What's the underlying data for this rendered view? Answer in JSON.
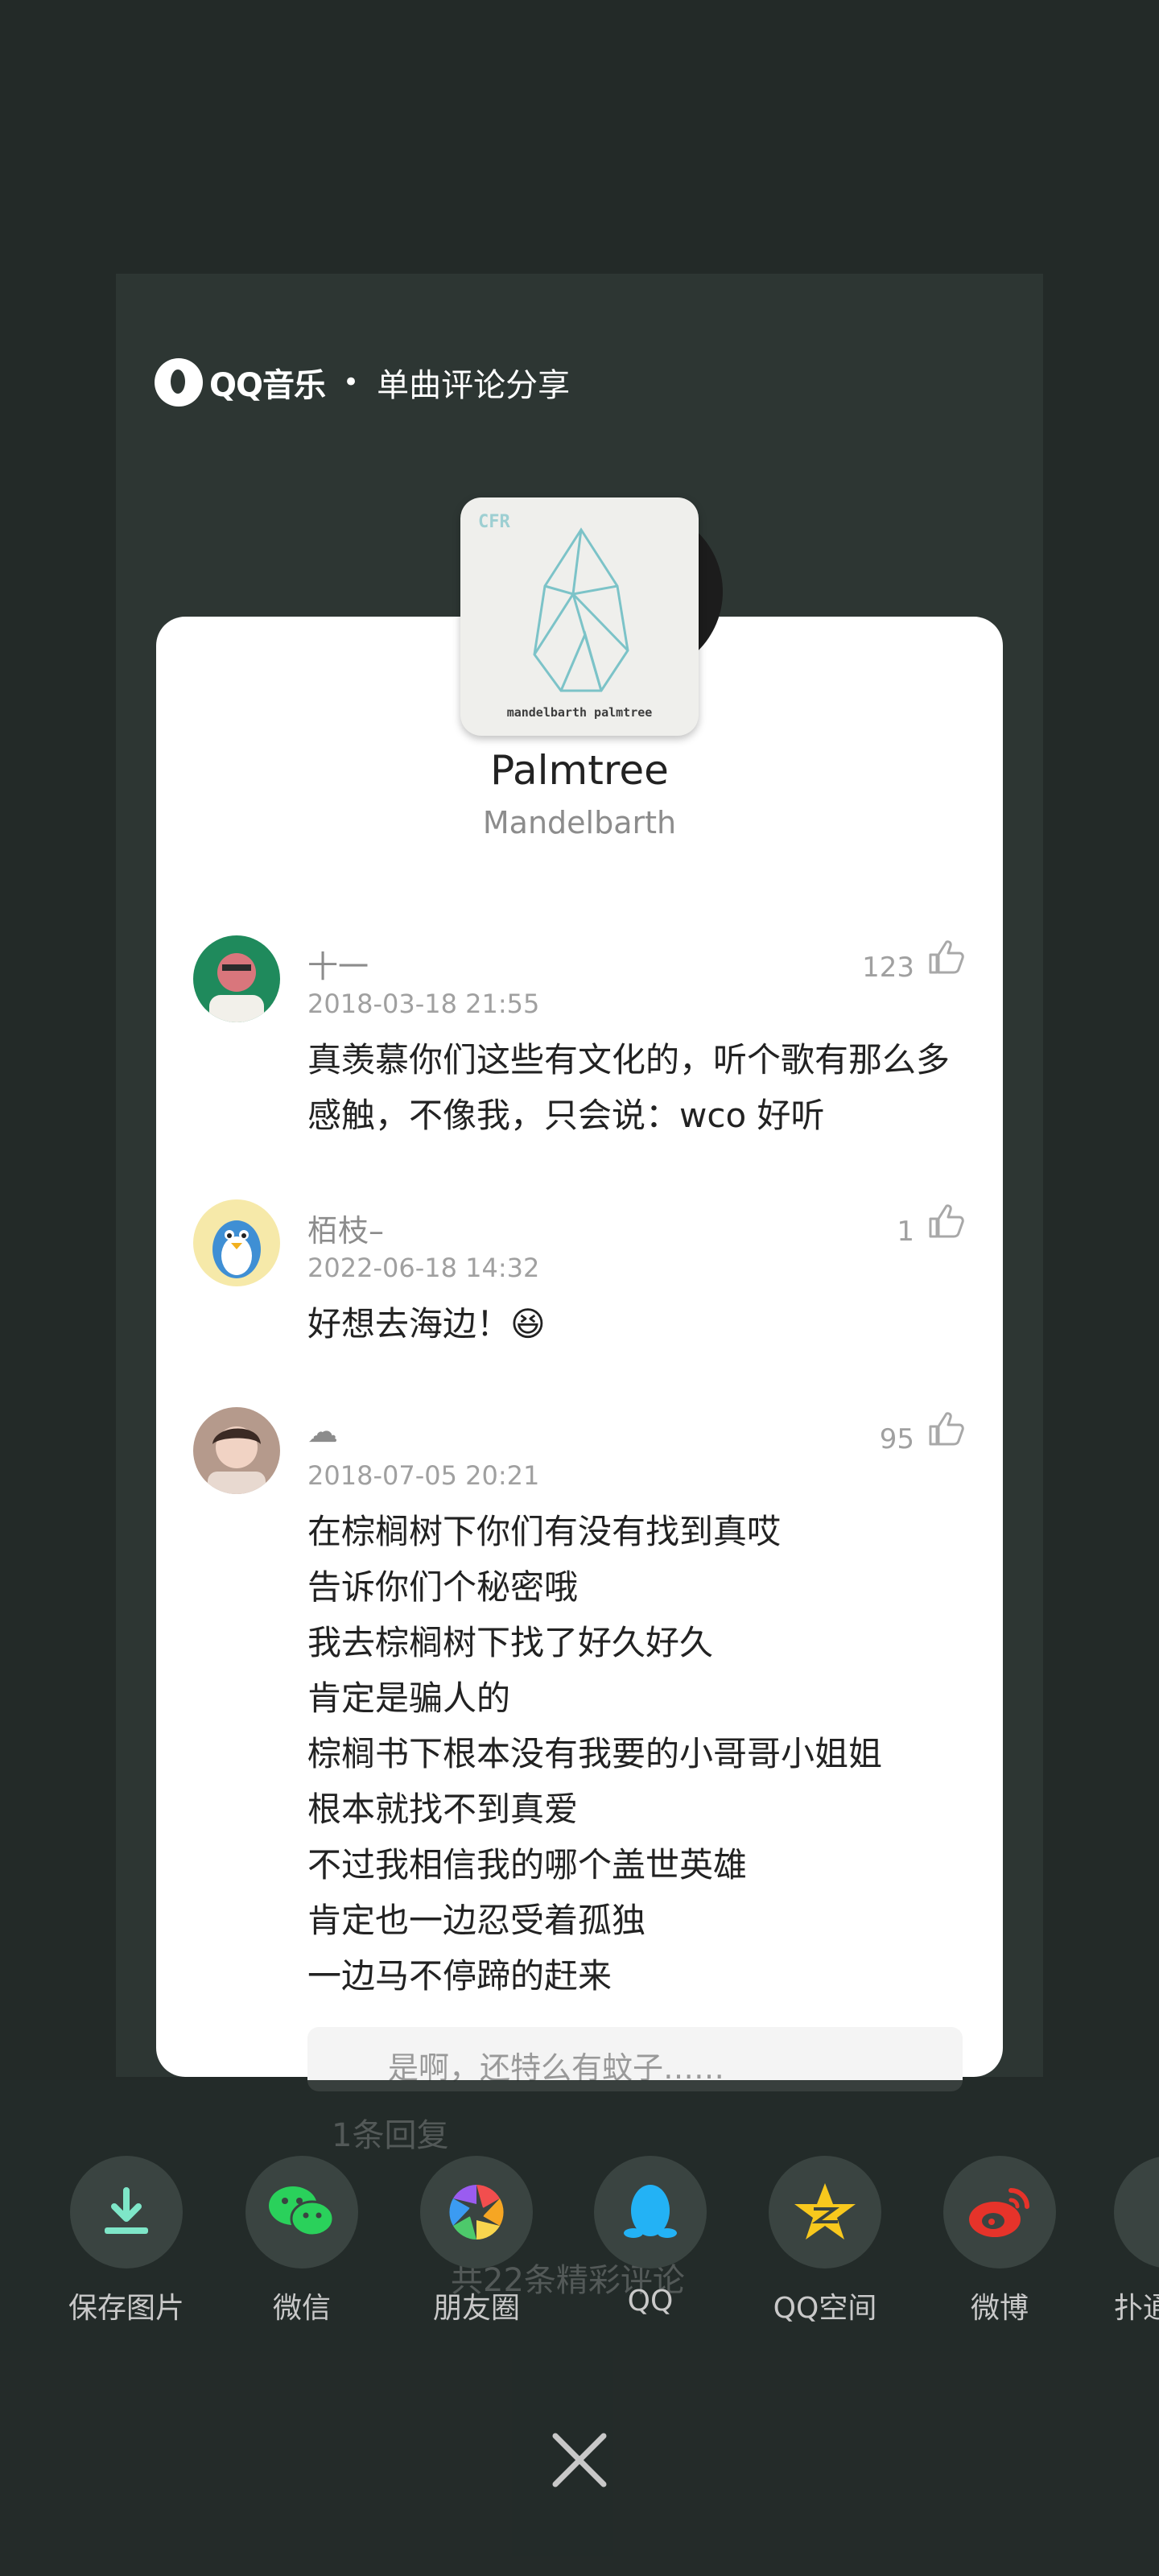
{
  "header": {
    "brand": "QQ音乐",
    "separator": "•",
    "subtitle": "单曲评论分享"
  },
  "song": {
    "title": "Palmtree",
    "artist": "Mandelbarth",
    "cover_top": "CFR",
    "cover_bottom": "mandelbarth palmtree"
  },
  "comments": [
    {
      "user": "十一",
      "time": "2018-03-18 21:55",
      "likes": "123",
      "text": "真羡慕你们这些有文化的，听个歌有那么多感触，不像我，只会说：wco 好听"
    },
    {
      "user": "栢枝–",
      "time": "2022-06-18 14:32",
      "likes": "1",
      "text": "好想去海边！😆"
    },
    {
      "user": "☁",
      "time": "2018-07-05 20:21",
      "likes": "95",
      "lines": [
        "在棕榈树下你们有没有找到真哎",
        "告诉你们个秘密哦",
        "我去棕榈树下找了好久好久",
        "肯定是骗人的",
        "棕榈书下根本没有我要的小哥哥小姐姐",
        "根本就找不到真爱",
        "不过我相信我的哪个盖世英雄",
        "肯定也一边忍受着孤独",
        "一边马不停蹄的赶来"
      ]
    }
  ],
  "reply_preview": "是啊，还特么有蚊子……",
  "ghost": {
    "reply_count": "1条回复",
    "more_comments": "共22条精彩评论"
  },
  "share": {
    "items": [
      {
        "label": "保存图片",
        "icon": "download-icon"
      },
      {
        "label": "微信",
        "icon": "wechat-icon"
      },
      {
        "label": "朋友圈",
        "icon": "moments-icon"
      },
      {
        "label": "QQ",
        "icon": "qq-penguin-icon"
      },
      {
        "label": "QQ空间",
        "icon": "qzone-star-icon"
      },
      {
        "label": "微博",
        "icon": "weibo-icon"
      },
      {
        "label": "扑通",
        "icon": "putong-icon"
      }
    ]
  },
  "colors": {
    "accent_green": "#31c27c",
    "background": "#232a28",
    "card": "#ffffff"
  }
}
